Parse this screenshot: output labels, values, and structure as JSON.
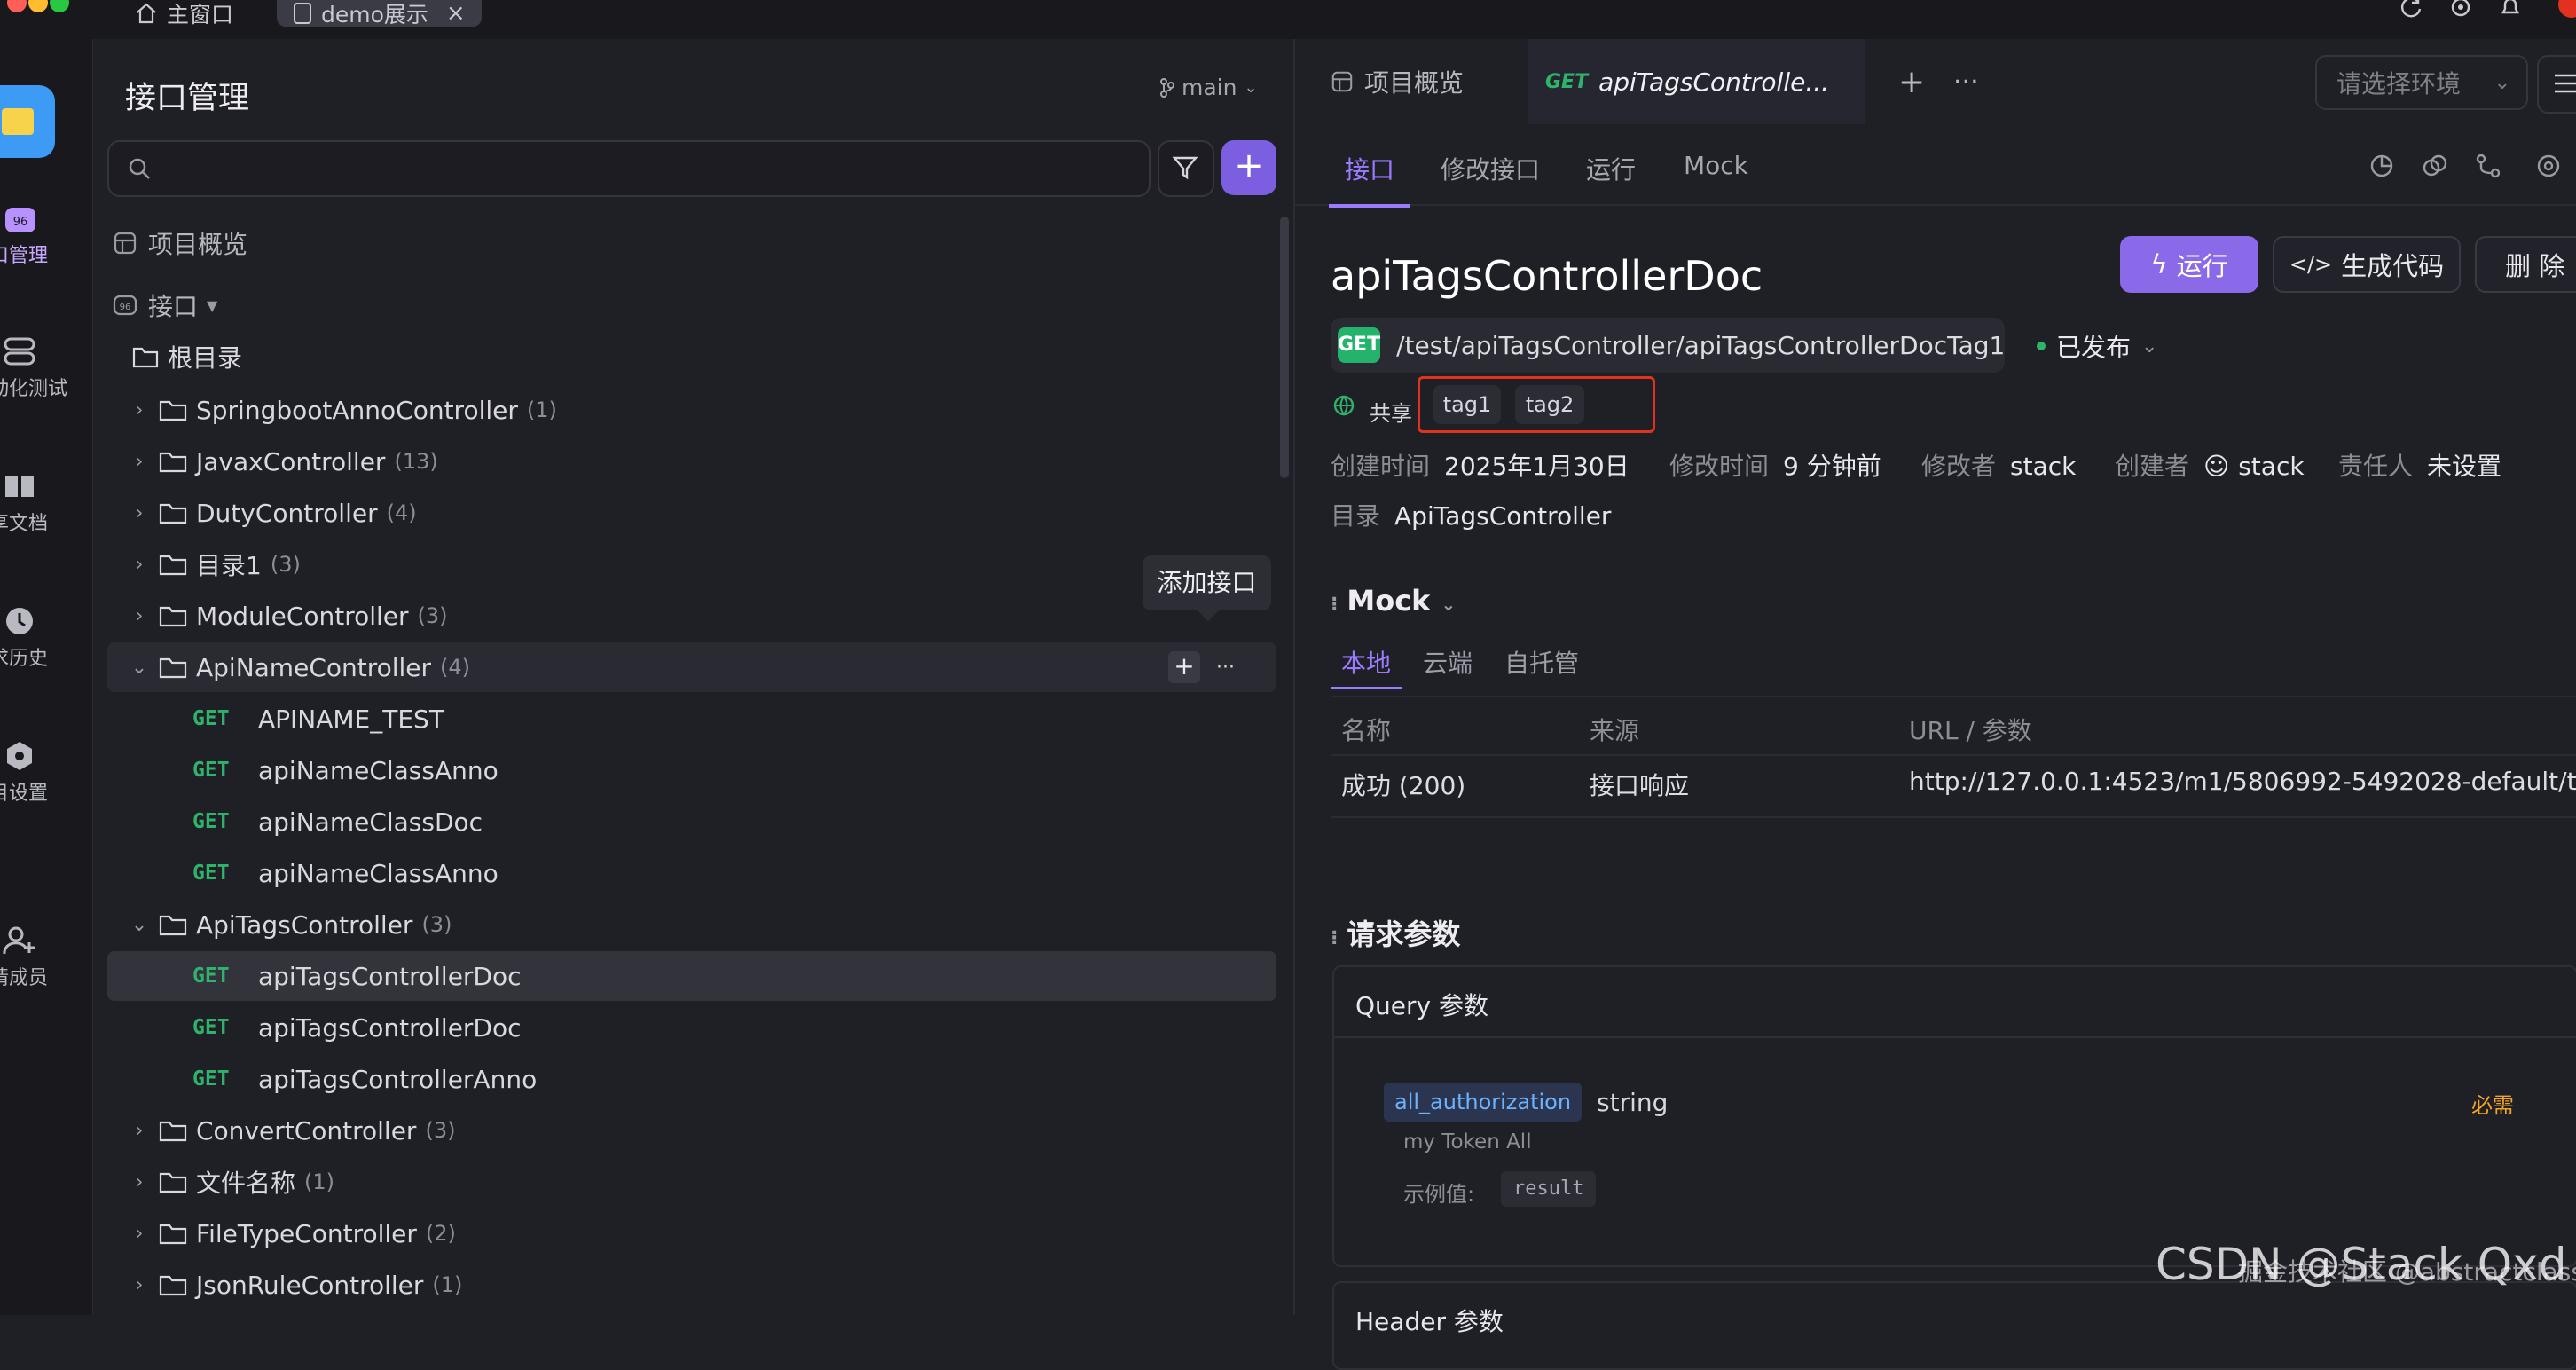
{
  "window": {
    "tabs": [
      {
        "label": "主窗口"
      },
      {
        "label": "demo展示"
      }
    ],
    "close_glyph": "×"
  },
  "rail": {
    "items": [
      {
        "label": "口管理",
        "icon": "api-icon"
      },
      {
        "label": "动化测试",
        "icon": "automation-icon"
      },
      {
        "label": "享文档",
        "icon": "book-icon"
      },
      {
        "label": "求历史",
        "icon": "clock-icon"
      },
      {
        "label": "目设置",
        "icon": "settings-icon"
      },
      {
        "label": "请成员",
        "icon": "add-member-icon"
      }
    ]
  },
  "sidebar": {
    "title": "接口管理",
    "branch": "main",
    "add_symbol": "+",
    "nav": [
      {
        "label": "项目概览"
      },
      {
        "label": "接口"
      }
    ],
    "root": "根目录",
    "tree": [
      {
        "type": "folder",
        "label": "SpringbootAnnoController",
        "count": "(1)",
        "expanded": false
      },
      {
        "type": "folder",
        "label": "JavaxController",
        "count": "(13)",
        "expanded": false
      },
      {
        "type": "folder",
        "label": "DutyController",
        "count": "(4)",
        "expanded": false
      },
      {
        "type": "folder",
        "label": "目录1",
        "count": "(3)",
        "expanded": false
      },
      {
        "type": "folder",
        "label": "ModuleController",
        "count": "(3)",
        "expanded": false
      },
      {
        "type": "folder",
        "label": "ApiNameController",
        "count": "(4)",
        "expanded": true
      },
      {
        "type": "api",
        "method": "GET",
        "label": "APINAME_TEST"
      },
      {
        "type": "api",
        "method": "GET",
        "label": "apiNameClassAnno"
      },
      {
        "type": "api",
        "method": "GET",
        "label": "apiNameClassDoc"
      },
      {
        "type": "api",
        "method": "GET",
        "label": "apiNameClassAnno"
      },
      {
        "type": "folder",
        "label": "ApiTagsController",
        "count": "(3)",
        "expanded": true
      },
      {
        "type": "api",
        "method": "GET",
        "label": "apiTagsControllerDoc"
      },
      {
        "type": "api",
        "method": "GET",
        "label": "apiTagsControllerDoc"
      },
      {
        "type": "api",
        "method": "GET",
        "label": "apiTagsControllerAnno"
      },
      {
        "type": "folder",
        "label": "ConvertController",
        "count": "(3)",
        "expanded": false
      },
      {
        "type": "folder",
        "label": "文件名称",
        "count": "(1)",
        "expanded": false
      },
      {
        "type": "folder",
        "label": "FileTypeController",
        "count": "(2)",
        "expanded": false
      },
      {
        "type": "folder",
        "label": "JsonRuleController",
        "count": "(1)",
        "expanded": false
      }
    ],
    "tooltip": "添加接口",
    "row_actions": {
      "add": "+",
      "more": "···"
    }
  },
  "main": {
    "tabs": [
      {
        "label": "项目概览"
      },
      {
        "method": "GET",
        "label": "apiTagsControlle..."
      }
    ],
    "new_tab": "+",
    "more": "···",
    "env_placeholder": "请选择环境",
    "subtabs": [
      "接口",
      "修改接口",
      "运行",
      "Mock"
    ],
    "title": "apiTagsControllerDoc",
    "buttons": {
      "run": "运行",
      "gen_code": "生成代码",
      "delete": "删 除"
    },
    "method": "GET",
    "url": "/test/apiTagsController/apiTagsControllerDocTag1",
    "status": "已发布",
    "status_color": "#2fb36a",
    "share_label": "共享",
    "tags": [
      "tag1",
      "tag2"
    ],
    "meta": {
      "created_at_label": "创建时间",
      "created_at": "2025年1月30日",
      "modified_at_label": "修改时间",
      "modified_at": "9 分钟前",
      "modifier_label": "修改者",
      "modifier": "stack",
      "creator_label": "创建者",
      "creator": "stack",
      "owner_label": "责任人",
      "owner": "未设置",
      "dir_label": "目录",
      "dir": "ApiTagsController"
    },
    "mock": {
      "title": "Mock",
      "tabs": [
        "本地",
        "云端",
        "自托管"
      ],
      "columns": [
        "名称",
        "来源",
        "URL / 参数"
      ],
      "rows": [
        {
          "name": "成功 (200)",
          "source": "接口响应",
          "url": "http://127.0.0.1:4523/m1/5806992-5492028-default/t..."
        }
      ]
    },
    "request": {
      "title": "请求参数",
      "query_title": "Query 参数",
      "params": [
        {
          "name": "all_authorization",
          "type": "string",
          "required": "必需",
          "desc": "my Token All",
          "example_label": "示例值:",
          "example": "result"
        }
      ],
      "header_title": "Header 参数"
    }
  },
  "watermark": {
    "text": "CSDN @Stack Qxd",
    "overlay": "掘金技术社区 @abstractclass"
  },
  "colors": {
    "accent": "#8a6ae8",
    "get": "#2fb36a",
    "highlight_box": "#e0321e"
  }
}
